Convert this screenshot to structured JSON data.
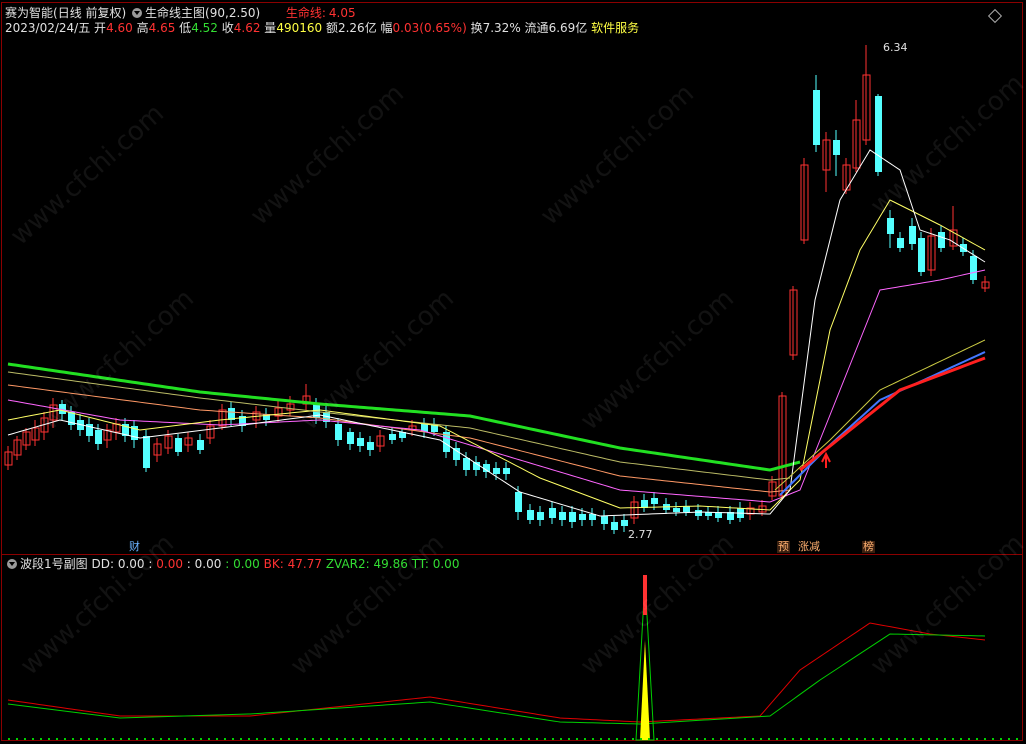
{
  "header": {
    "app_name": "赛为智能",
    "period": "(日线 前复权)",
    "indicator_name": "生命线主图",
    "indicator_params": "(90,2.50)",
    "lifeline_label": "生命线:",
    "lifeline_value": "4.05"
  },
  "quote": {
    "date": "2023/02/24/五",
    "open_label": "开",
    "open": "4.60",
    "high_label": "高",
    "high": "4.65",
    "low_label": "低",
    "low": "4.52",
    "close_label": "收",
    "close": "4.62",
    "volume_label": "量",
    "volume": "490160",
    "amount_label": "额",
    "amount": "2.26亿",
    "change_label": "幅",
    "change": "0.03(0.65%)",
    "turnover_label": "换",
    "turnover": "7.32%",
    "float_label": "流通",
    "float_value": "6.69亿",
    "service": "软件服务"
  },
  "annotations": {
    "high_price": "6.34",
    "low_price": "2.77",
    "event_cai": "财",
    "event_yu": "预",
    "event_zhangjian": "涨减",
    "event_bang": "榜"
  },
  "sub_indicator": {
    "name": "波段1号副图",
    "dd_label": "DD:",
    "dd_value": "0.00",
    "v2": "0.00",
    "v3": "0.00",
    "v4": "0.00",
    "bk_label": "BK:",
    "bk_value": "47.77",
    "zvar2_label": "ZVAR2:",
    "zvar2_value": "49.86",
    "tt_label": "TT:",
    "tt_value": "0.00"
  },
  "watermark": "www.cfchi.com",
  "colors": {
    "up": "#ff3232",
    "down": "#54ffff",
    "lifeline": "#22e022",
    "ma_white": "#ffffff",
    "ma_yellow": "#ffff66",
    "ma_magenta": "#ff66ff",
    "ma_orange": "#ff9966",
    "ma_olive": "#cccc44",
    "ma_blue": "#4477ff",
    "ma_red": "#ff2020",
    "bk_line": "#e00000",
    "zvar2_line": "#00d000",
    "spike_yellow": "#ffff00"
  }
}
